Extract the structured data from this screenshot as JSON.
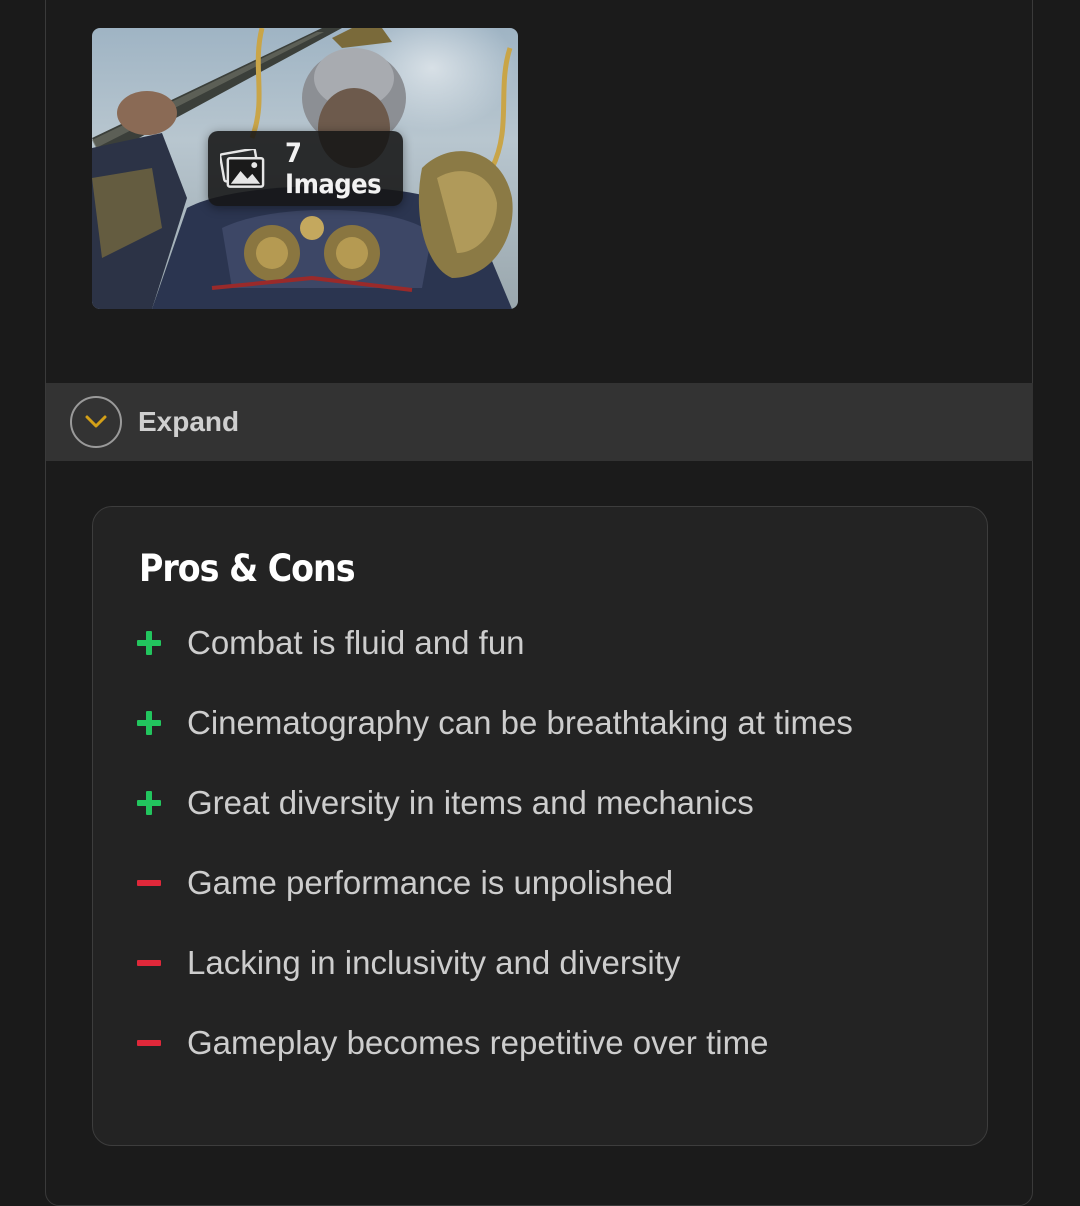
{
  "gallery": {
    "badge_text": "7 Images",
    "icon": "image-gallery-icon"
  },
  "expand": {
    "label": "Expand",
    "icon": "chevron-down-icon",
    "chevron_color": "#d4a018"
  },
  "pros_cons": {
    "title": "Pros & Cons",
    "pro_color": "#22c55e",
    "con_color": "#e0283a",
    "items": [
      {
        "type": "pro",
        "text": "Combat is fluid and fun"
      },
      {
        "type": "pro",
        "text": "Cinematography can be breathtaking at times"
      },
      {
        "type": "pro",
        "text": "Great diversity in items and mechanics"
      },
      {
        "type": "con",
        "text": "Game performance is unpolished"
      },
      {
        "type": "con",
        "text": "Lacking in inclusivity and diversity"
      },
      {
        "type": "con",
        "text": "Gameplay becomes repetitive over time"
      }
    ]
  }
}
